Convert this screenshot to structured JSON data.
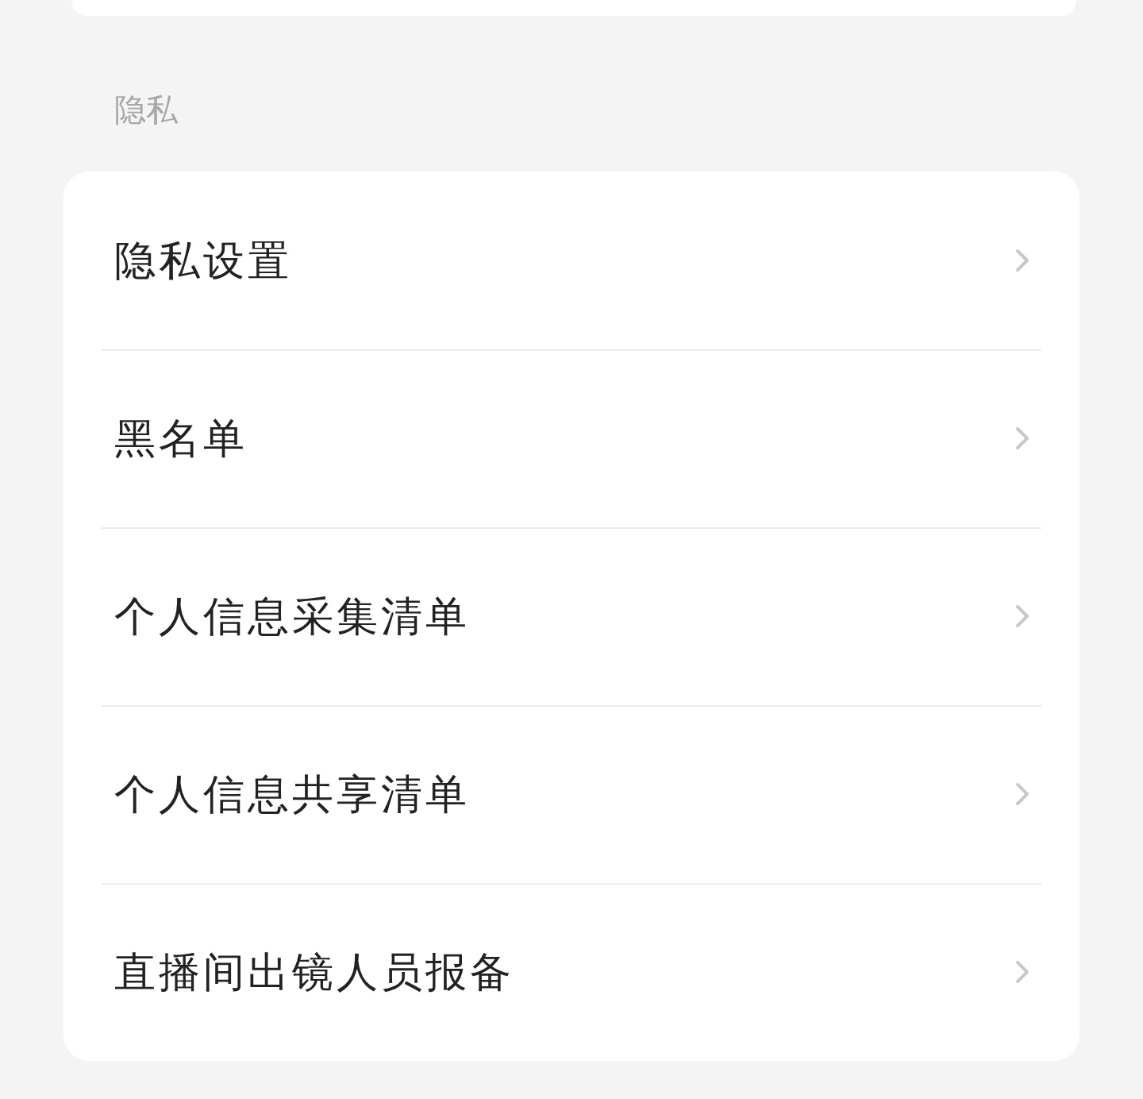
{
  "section": {
    "title": "隐私"
  },
  "items": [
    {
      "label": "隐私设置"
    },
    {
      "label": "黑名单"
    },
    {
      "label": "个人信息采集清单"
    },
    {
      "label": "个人信息共享清单"
    },
    {
      "label": "直播间出镜人员报备"
    }
  ]
}
